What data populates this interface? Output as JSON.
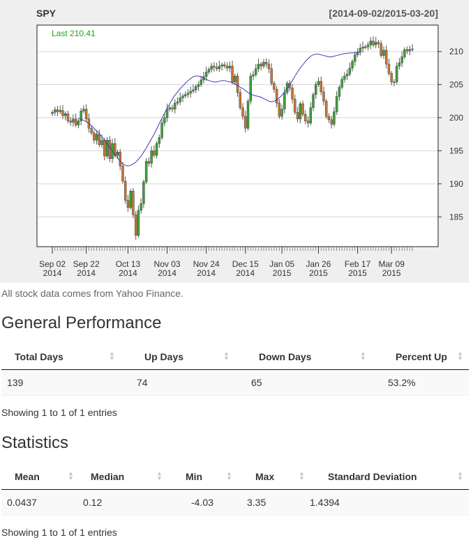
{
  "chart": {
    "title": "SPY",
    "range": "[2014-09-02/2015-03-20]",
    "last_label": "Last 210.41",
    "colors": {
      "up": "#3aa237",
      "down": "#c87533",
      "ma": "#3a3ab8",
      "last": "#1da31d"
    }
  },
  "chart_data": {
    "type": "candlestick",
    "title": "SPY",
    "subtitle": "[2014-09-02/2015-03-20]",
    "annotation": "Last 210.41",
    "yticks": [
      185,
      190,
      195,
      200,
      205,
      210
    ],
    "ylim": [
      180.5,
      214
    ],
    "grid": true,
    "xticks": [
      {
        "label": [
          "Sep 02",
          "2014"
        ],
        "index": 0
      },
      {
        "label": [
          "Sep 22",
          "2014"
        ],
        "index": 13
      },
      {
        "label": [
          "Oct 13",
          "2014"
        ],
        "index": 29
      },
      {
        "label": [
          "Nov 03",
          "2014"
        ],
        "index": 44
      },
      {
        "label": [
          "Nov 24",
          "2014"
        ],
        "index": 59
      },
      {
        "label": [
          "Dec 15",
          "2014"
        ],
        "index": 74
      },
      {
        "label": [
          "Jan 05",
          "2015"
        ],
        "index": 88
      },
      {
        "label": [
          "Jan 26",
          "2015"
        ],
        "index": 102
      },
      {
        "label": [
          "Feb 17",
          "2015"
        ],
        "index": 117
      },
      {
        "label": [
          "Mar 09",
          "2015"
        ],
        "index": 130
      }
    ],
    "n_days": 139,
    "closes": [
      200.8,
      201.2,
      200.9,
      201.1,
      200.3,
      200.6,
      199.5,
      199.3,
      199.8,
      198.9,
      199.5,
      201.0,
      201.3,
      199.8,
      198.4,
      197.7,
      196.6,
      197.5,
      195.9,
      196.6,
      194.2,
      196.6,
      193.8,
      196.1,
      194.3,
      194.8,
      192.7,
      190.4,
      187.5,
      186.4,
      188.9,
      185.3,
      182.2,
      186.0,
      187.0,
      190.3,
      193.4,
      193.1,
      195.0,
      194.3,
      196.1,
      197.0,
      199.2,
      200.0,
      201.3,
      201.5,
      201.3,
      202.2,
      202.4,
      203.0,
      203.3,
      203.5,
      203.7,
      204.0,
      204.2,
      204.7,
      205.0,
      205.7,
      206.2,
      206.9,
      207.3,
      207.8,
      207.6,
      207.4,
      207.8,
      208.0,
      207.8,
      207.5,
      207.8,
      205.4,
      206.3,
      203.8,
      201.5,
      200.2,
      198.4,
      202.5,
      206.3,
      206.5,
      207.4,
      208.1,
      207.8,
      208.4,
      208.1,
      207.4,
      205.2,
      204.3,
      202.2,
      200.2,
      201.3,
      203.8,
      205.2,
      204.5,
      202.8,
      200.8,
      199.8,
      202.1,
      200.5,
      199.5,
      199.2,
      201.5,
      203.5,
      205.0,
      205.5,
      203.9,
      202.5,
      200.2,
      199.7,
      199.0,
      200.9,
      203.2,
      204.6,
      205.8,
      206.3,
      206.6,
      207.5,
      208.5,
      209.5,
      209.9,
      210.5,
      210.7,
      210.7,
      211.0,
      211.6,
      211.0,
      211.4,
      211.2,
      209.4,
      210.2,
      208.1,
      206.7,
      205.4,
      205.4,
      207.8,
      208.3,
      209.2,
      210.3,
      210.1,
      210.3,
      210.4
    ],
    "opens": [
      200.6,
      200.8,
      201.2,
      200.9,
      201.1,
      200.3,
      200.6,
      199.5,
      199.3,
      199.8,
      198.9,
      199.5,
      201.0,
      201.3,
      199.8,
      198.4,
      197.7,
      196.6,
      197.5,
      195.9,
      196.6,
      194.2,
      196.6,
      193.8,
      196.1,
      194.3,
      194.8,
      192.7,
      190.4,
      187.5,
      186.4,
      188.9,
      185.3,
      182.2,
      186.0,
      187.0,
      190.3,
      193.4,
      193.1,
      195.0,
      194.3,
      196.1,
      197.0,
      199.2,
      200.0,
      201.3,
      201.5,
      201.3,
      202.2,
      202.4,
      203.0,
      203.3,
      203.5,
      203.7,
      204.0,
      204.2,
      204.7,
      205.0,
      205.7,
      206.2,
      206.9,
      207.3,
      207.8,
      207.6,
      207.4,
      207.8,
      208.0,
      207.8,
      207.5,
      207.8,
      205.4,
      206.3,
      203.8,
      201.5,
      200.2,
      198.4,
      202.5,
      206.3,
      206.5,
      207.4,
      208.1,
      207.8,
      208.4,
      208.1,
      207.4,
      205.2,
      204.3,
      202.2,
      200.2,
      201.3,
      203.8,
      205.2,
      204.5,
      202.8,
      200.8,
      199.8,
      202.1,
      200.5,
      199.5,
      199.2,
      201.5,
      203.5,
      205.0,
      205.5,
      203.9,
      202.5,
      200.2,
      199.7,
      199.0,
      200.9,
      203.2,
      204.6,
      205.8,
      206.3,
      206.6,
      207.5,
      208.5,
      209.5,
      209.9,
      210.5,
      210.7,
      210.7,
      211.0,
      211.6,
      211.0,
      211.4,
      211.2,
      209.4,
      210.2,
      208.1,
      206.7,
      205.4,
      205.4,
      207.8,
      208.3,
      209.2,
      210.3,
      210.1,
      210.3
    ],
    "ma_start_index": 10,
    "ma": [
      199.9,
      199.8,
      199.6,
      199.4,
      199.1,
      198.8,
      198.4,
      198.0,
      197.6,
      197.1,
      196.6,
      196.1,
      195.5,
      195.0,
      194.4,
      193.9,
      193.4,
      193.0,
      192.8,
      192.7,
      192.8,
      193.0,
      193.3,
      193.7,
      194.2,
      194.8,
      195.4,
      196.1,
      196.8,
      197.5,
      198.3,
      199.1,
      199.9,
      200.7,
      201.4,
      202.1,
      202.8,
      203.4,
      203.9,
      204.4,
      204.8,
      205.2,
      205.6,
      205.9,
      206.2,
      206.3,
      206.3,
      206.2,
      206.0,
      205.8,
      205.6,
      205.5,
      205.4,
      205.4,
      205.5,
      205.6,
      205.6,
      205.5,
      205.4,
      205.3,
      205.1,
      204.9,
      204.6,
      204.4,
      204.1,
      203.8,
      203.6,
      203.4,
      203.3,
      203.2,
      203.1,
      202.9,
      202.7,
      202.5,
      202.4,
      202.5,
      202.7,
      203.0,
      203.4,
      203.9,
      204.4,
      205.0,
      205.6,
      206.3,
      206.9,
      207.5,
      208.0,
      208.5,
      208.9,
      209.3,
      209.5,
      209.6,
      209.6,
      209.5,
      209.4,
      209.3,
      209.2,
      209.2,
      209.3,
      209.4,
      209.5,
      209.6,
      209.7,
      209.7,
      209.8,
      209.8,
      209.8,
      209.9,
      209.9
    ]
  },
  "source_note": "All stock data comes from Yahoo Finance.",
  "performance": {
    "title": "General Performance",
    "columns": [
      "Total Days",
      "Up Days",
      "Down Days",
      "Percent Up"
    ],
    "rows": [
      [
        "139",
        "74",
        "65",
        "53.2%"
      ]
    ],
    "info": "Showing 1 to 1 of 1 entries"
  },
  "statistics": {
    "title": "Statistics",
    "columns": [
      "Mean",
      "Median",
      "Min",
      "Max",
      "Standard Deviation"
    ],
    "rows": [
      [
        "0.0437",
        "0.12",
        "-4.03",
        "3.35",
        "1.4394"
      ]
    ],
    "info": "Showing 1 to 1 of 1 entries"
  }
}
